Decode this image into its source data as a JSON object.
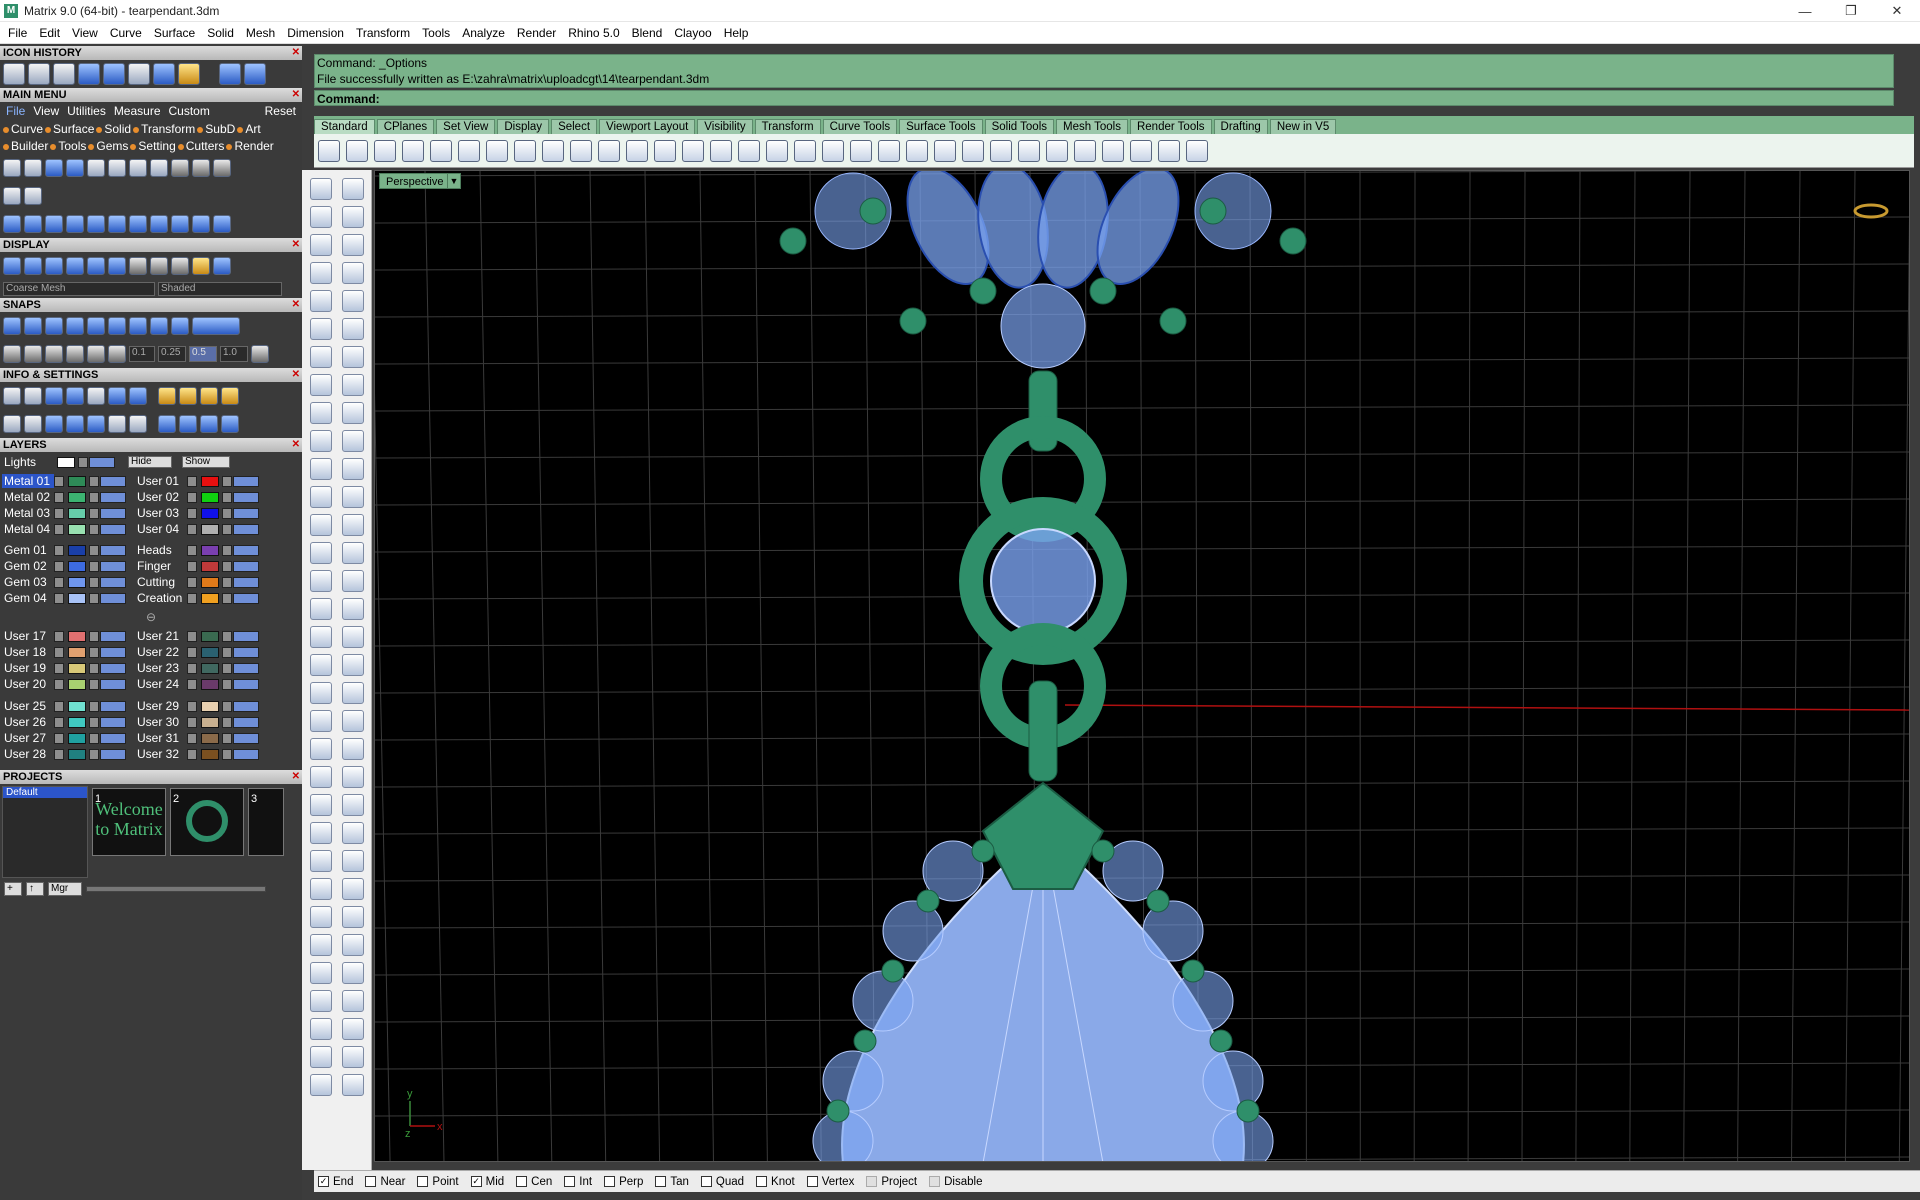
{
  "window": {
    "title": "Matrix 9.0 (64-bit) - tearpendant.3dm",
    "controls": {
      "minimize": "—",
      "restore": "❐",
      "close": "✕"
    }
  },
  "menubar": [
    "File",
    "Edit",
    "View",
    "Curve",
    "Surface",
    "Solid",
    "Mesh",
    "Dimension",
    "Transform",
    "Tools",
    "Analyze",
    "Render",
    "Rhino 5.0",
    "Blend",
    "Clayoo",
    "Help"
  ],
  "panels": {
    "icon_history": "ICON HISTORY",
    "main_menu": "MAIN MENU",
    "display": "DISPLAY",
    "snaps": "SNAPS",
    "info_settings": "INFO & SETTINGS",
    "layers": "LAYERS",
    "projects": "PROJECTS"
  },
  "main_menu": {
    "tabs": [
      "File",
      "View",
      "Utilities",
      "Measure",
      "Custom",
      "Reset"
    ],
    "row1": [
      "Curve",
      "Surface",
      "Solid",
      "Transform",
      "SubD",
      "Art"
    ],
    "row2": [
      "Builder",
      "Tools",
      "Gems",
      "Setting",
      "Cutters",
      "Render"
    ]
  },
  "display": {
    "mesh_mode": "Coarse Mesh",
    "shade_mode": "Shaded"
  },
  "snaps": {
    "values": [
      "0.1",
      "0.25",
      "0.5",
      "1.0"
    ]
  },
  "layers": {
    "lights": "Lights",
    "hide": "Hide",
    "show": "Show",
    "left_group1": [
      {
        "name": "Metal 01",
        "color": "#2e8b57"
      },
      {
        "name": "Metal 02",
        "color": "#3cb371"
      },
      {
        "name": "Metal 03",
        "color": "#66cdaa"
      },
      {
        "name": "Metal 04",
        "color": "#98e0b0"
      }
    ],
    "right_group1": [
      {
        "name": "User 01",
        "color": "#e81010"
      },
      {
        "name": "User 02",
        "color": "#10d010"
      },
      {
        "name": "User 03",
        "color": "#1010e8"
      },
      {
        "name": "User 04",
        "color": "#b0b0b0"
      }
    ],
    "left_group2": [
      {
        "name": "Gem 01",
        "color": "#1a3fa8"
      },
      {
        "name": "Gem 02",
        "color": "#3d6be0"
      },
      {
        "name": "Gem 03",
        "color": "#6f96ee"
      },
      {
        "name": "Gem 04",
        "color": "#a8c2f6"
      }
    ],
    "right_group2": [
      {
        "name": "Heads",
        "color": "#7a3fb0"
      },
      {
        "name": "Finger",
        "color": "#c03a3a"
      },
      {
        "name": "Cutting",
        "color": "#e07a1a"
      },
      {
        "name": "Creation",
        "color": "#f0a020"
      }
    ],
    "left_group3": [
      {
        "name": "User 17",
        "color": "#e07070"
      },
      {
        "name": "User 18",
        "color": "#e0a070"
      },
      {
        "name": "User 19",
        "color": "#d8c878"
      },
      {
        "name": "User 20",
        "color": "#a8d070"
      },
      {
        "name": "User 25",
        "color": "#70e0d0"
      },
      {
        "name": "User 26",
        "color": "#40c8c0"
      },
      {
        "name": "User 27",
        "color": "#20a0a0"
      },
      {
        "name": "User 28",
        "color": "#208080"
      }
    ],
    "right_group3": [
      {
        "name": "User 21",
        "color": "#3a6a50"
      },
      {
        "name": "User 22",
        "color": "#2a6070"
      },
      {
        "name": "User 23",
        "color": "#406860"
      },
      {
        "name": "User 24",
        "color": "#6a3a6a"
      },
      {
        "name": "User 29",
        "color": "#e8d0b0"
      },
      {
        "name": "User 30",
        "color": "#c8b090"
      },
      {
        "name": "User 31",
        "color": "#8a6a4a"
      },
      {
        "name": "User 32",
        "color": "#7a5020"
      }
    ]
  },
  "projects": {
    "list_item": "Default",
    "thumbs": [
      {
        "num": "1",
        "caption": "Welcome to Matrix"
      },
      {
        "num": "2",
        "caption": ""
      },
      {
        "num": "3",
        "caption": ""
      }
    ],
    "mgr_button": "Mgr"
  },
  "command": {
    "line1": "Command: _Options",
    "line2": "File successfully written as E:\\zahra\\matrix\\uploadcgt\\14\\tearpendant.3dm",
    "prompt": "Command:"
  },
  "toolbar_tabs": [
    "Standard",
    "CPlanes",
    "Set View",
    "Display",
    "Select",
    "Viewport Layout",
    "Visibility",
    "Transform",
    "Curve Tools",
    "Surface Tools",
    "Solid Tools",
    "Mesh Tools",
    "Render Tools",
    "Drafting",
    "New in V5"
  ],
  "viewport": {
    "label": "Perspective",
    "axis_y": "y",
    "axis_z": "z",
    "axis_x": "x"
  },
  "osnaps": [
    {
      "label": "End",
      "checked": true
    },
    {
      "label": "Near",
      "checked": false
    },
    {
      "label": "Point",
      "checked": false
    },
    {
      "label": "Mid",
      "checked": true
    },
    {
      "label": "Cen",
      "checked": false
    },
    {
      "label": "Int",
      "checked": false
    },
    {
      "label": "Perp",
      "checked": false
    },
    {
      "label": "Tan",
      "checked": false
    },
    {
      "label": "Quad",
      "checked": false
    },
    {
      "label": "Knot",
      "checked": false
    },
    {
      "label": "Vertex",
      "checked": false
    },
    {
      "label": "Project",
      "checked": false,
      "disabled": true
    },
    {
      "label": "Disable",
      "checked": false,
      "disabled": true
    }
  ],
  "colors": {
    "command_bg": "#7ab38a",
    "metal_green": "#2f8f6a",
    "gem_blue": "#7aa3f0",
    "viewport_bg": "#000000",
    "grid": "#3a3a3a",
    "x_axis": "#b01010"
  }
}
